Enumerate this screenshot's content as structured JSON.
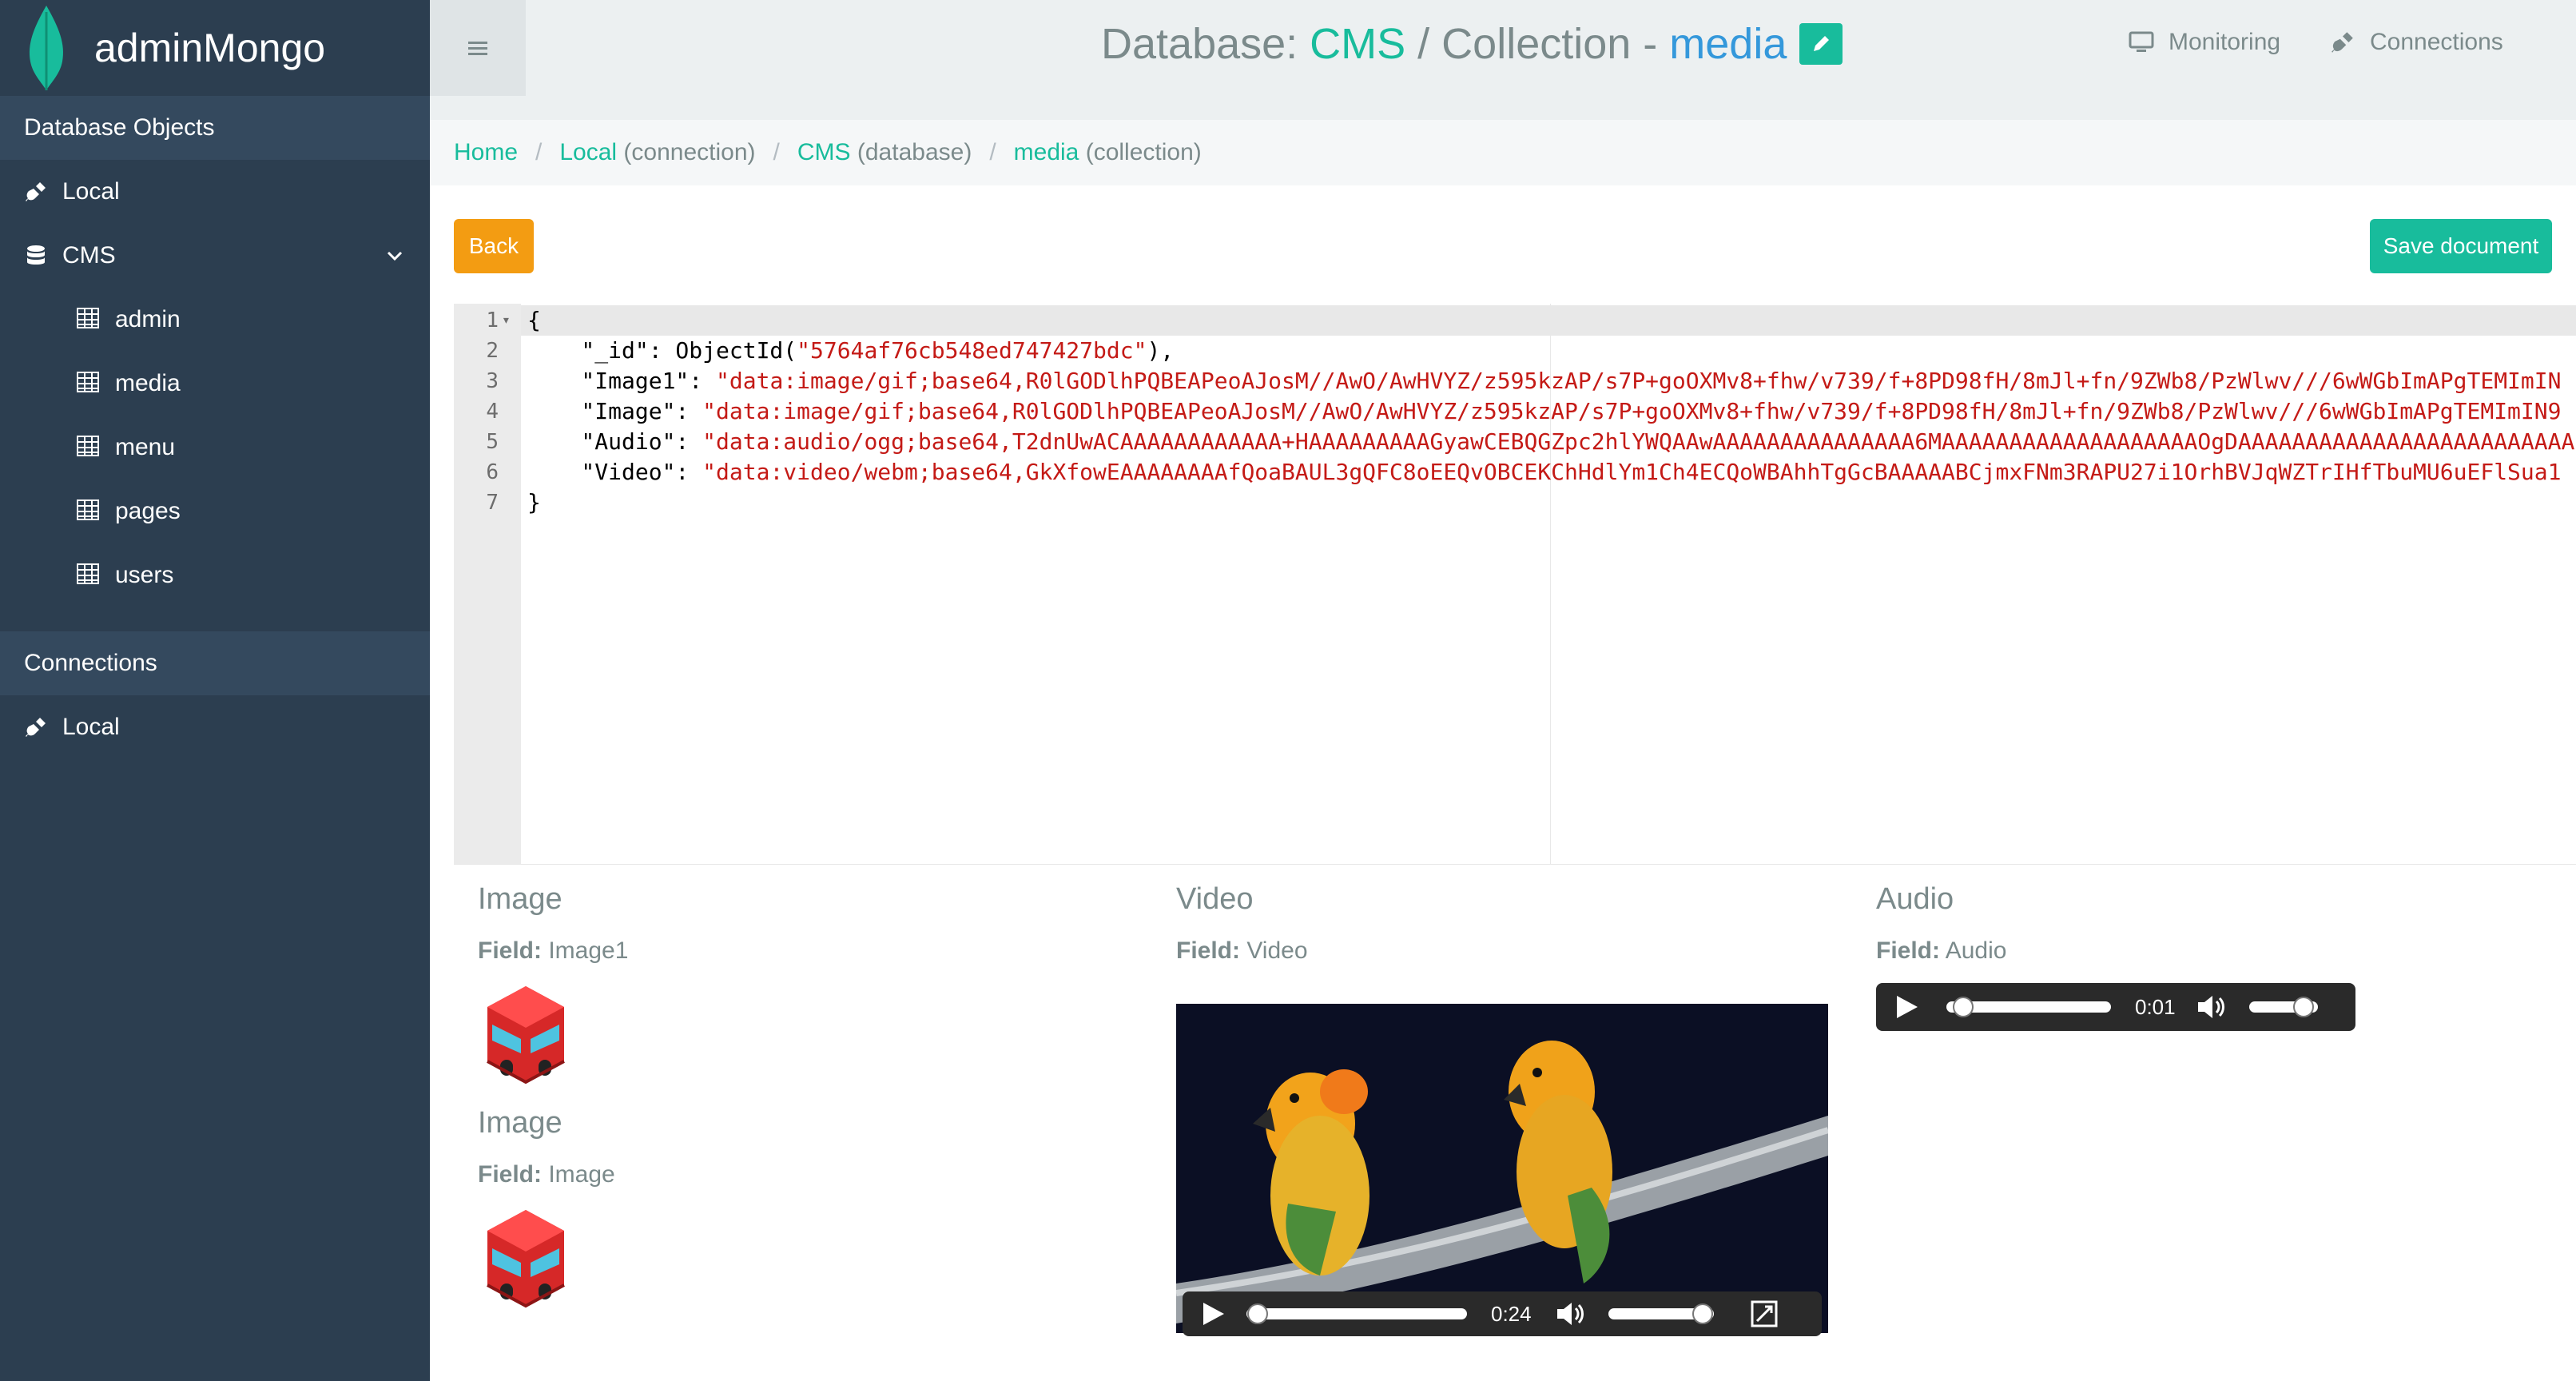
{
  "brand": {
    "name": "adminMongo"
  },
  "sidebar": {
    "db_objects_header": "Database Objects",
    "connection_item": "Local",
    "database": {
      "label": "CMS",
      "expanded": true
    },
    "collections": [
      "admin",
      "media",
      "menu",
      "pages",
      "users"
    ],
    "connections_header": "Connections",
    "connections": [
      "Local"
    ]
  },
  "header": {
    "title_prefix": "Database: ",
    "database": "CMS",
    "separator": " / Collection - ",
    "collection": "media",
    "nav": [
      {
        "label": "Monitoring",
        "icon": "monitor-icon"
      },
      {
        "label": "Connections",
        "icon": "plug-icon"
      }
    ]
  },
  "breadcrumb": [
    {
      "link": "Home",
      "suffix": ""
    },
    {
      "link": "Local",
      "suffix": " (connection)"
    },
    {
      "link": "CMS",
      "suffix": " (database)"
    },
    {
      "link": "media",
      "suffix": " (collection)"
    }
  ],
  "buttons": {
    "back": "Back",
    "save": "Save document"
  },
  "editor": {
    "lines": [
      {
        "n": "1",
        "key": "",
        "value": "{"
      },
      {
        "n": "2",
        "key": "    \"_id\": ObjectId(",
        "value": "\"5764af76cb548ed747427bdc\"",
        "tail": "),"
      },
      {
        "n": "3",
        "key": "    \"Image1\": ",
        "value": "\"data:image/gif;base64,R0lGODlhPQBEAPeoAJosM//AwO/AwHVYZ/z595kzAP/s7P+goOXMv8+fhw/v739/f+8PD98fH/8mJl+fn/9ZWb8/PzWlwv///6wWGbImAPgTEMImIN",
        "tail": ""
      },
      {
        "n": "4",
        "key": "    \"Image\": ",
        "value": "\"data:image/gif;base64,R0lGODlhPQBEAPeoAJosM//AwO/AwHVYZ/z595kzAP/s7P+goOXMv8+fhw/v739/f+8PD98fH/8mJl+fn/9ZWb8/PzWlwv///6wWGbImAPgTEMImIN9",
        "tail": ""
      },
      {
        "n": "5",
        "key": "    \"Audio\": ",
        "value": "\"data:audio/ogg;base64,T2dnUwACAAAAAAAAAAAA+HAAAAAAAAAGyawCEBQGZpc2hlYWQAAwAAAAAAAAAAAAAAA6MAAAAAAAAAAAAAAAAAAAOgDAAAAAAAAAAAAAAAAAAAAAAAAA",
        "tail": ""
      },
      {
        "n": "6",
        "key": "    \"Video\": ",
        "value": "\"data:video/webm;base64,GkXfowEAAAAAAAAfQoaBAUL3gQFC8oEEQvOBCEKChHdlYm1Ch4ECQoWBAhhTgGcBAAAAABCjmxFNm3RAPU27i1OrhBVJqWZTrIHfTbuMU6uEFlSua1",
        "tail": ""
      },
      {
        "n": "7",
        "key": "",
        "value": "}"
      }
    ]
  },
  "media": {
    "image1": {
      "title": "Image",
      "field_label": "Field:",
      "field": "Image1"
    },
    "image2": {
      "title": "Image",
      "field_label": "Field:",
      "field": "Image"
    },
    "video": {
      "title": "Video",
      "field_label": "Field:",
      "field": "Video",
      "time": "0:24",
      "progress": 0.05,
      "volume": 0.9
    },
    "audio": {
      "title": "Audio",
      "field_label": "Field:",
      "field": "Audio",
      "time": "0:01",
      "progress": 0.1,
      "volume": 0.8
    }
  },
  "colors": {
    "sidebar": "#2c3e50",
    "accent_green": "#18bc9c",
    "accent_blue": "#3498db",
    "warning": "#f39c12"
  }
}
